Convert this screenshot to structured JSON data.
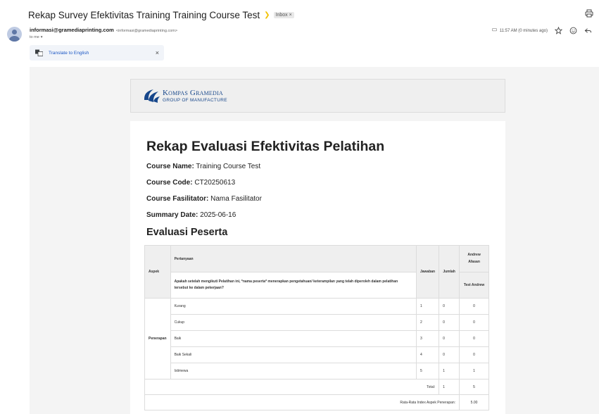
{
  "email": {
    "subject": "Rekap Survey Efektivitas Training Training Course Test",
    "label": "Inbox",
    "label_close": "×",
    "sender_name": "informasi@gramediaprinting.com",
    "sender_email": "<informasi@gramediaprinting.com>",
    "to": "to me",
    "timestamp": "11:57 AM (0 minutes ago)",
    "translate_label": "Translate to English",
    "translate_close": "×"
  },
  "icons": {
    "print": "print-icon",
    "star": "star-icon",
    "emoji": "emoji-icon",
    "reply": "reply-icon",
    "attachment": "label-icon",
    "translate": "translate-icon"
  },
  "logo": {
    "main": "Kompas Gramedia",
    "sub": "GROUP OF MANUFACTURE"
  },
  "report": {
    "title": "Rekap Evaluasi Efektivitas Pelatihan",
    "course_name_label": "Course Name:",
    "course_name": "Training Course Test",
    "course_code_label": "Course Code:",
    "course_code": "CT20250613",
    "facilitator_label": "Course Fasilitator:",
    "facilitator": "Nama Fasilitator",
    "summary_date_label": "Summary Date:",
    "summary_date": "2025-06-16",
    "section_title": "Evaluasi Peserta"
  },
  "table": {
    "headers": {
      "aspek": "Aspek",
      "pertanyaan": "Pertanyaan",
      "jawaban": "Jawaban",
      "jumlah": "Jumlah",
      "participant_name": "Andrew Afasan",
      "participant_test": "Test Andrew"
    },
    "aspek": "Penerapan",
    "question": "Apakah setelah mengikuti Pelatihan ini, *nama peserta* menerapkan pengetahuan/ keterampilan yang telah diperoleh dalam pelatihan tersebut ke dalam pekerjaan?",
    "rows": [
      {
        "answer": "Kurang",
        "jawaban": "1",
        "jumlah": "0",
        "score": "0"
      },
      {
        "answer": "Cukup",
        "jawaban": "2",
        "jumlah": "0",
        "score": "0"
      },
      {
        "answer": "Baik",
        "jawaban": "3",
        "jumlah": "0",
        "score": "0"
      },
      {
        "answer": "Baik Sekali",
        "jawaban": "4",
        "jumlah": "0",
        "score": "0"
      },
      {
        "answer": "Istimewa",
        "jawaban": "5",
        "jumlah": "1",
        "score": "1"
      }
    ],
    "total_label": "Total:",
    "total_jumlah": "1",
    "total_score": "5",
    "avg_label": "Rata-Rata Index Aspek Penerapan:",
    "avg_value": "5.00"
  },
  "colors": {
    "brand_blue": "#17478b",
    "link_blue": "#1a56c4",
    "important": "#f2c200"
  }
}
